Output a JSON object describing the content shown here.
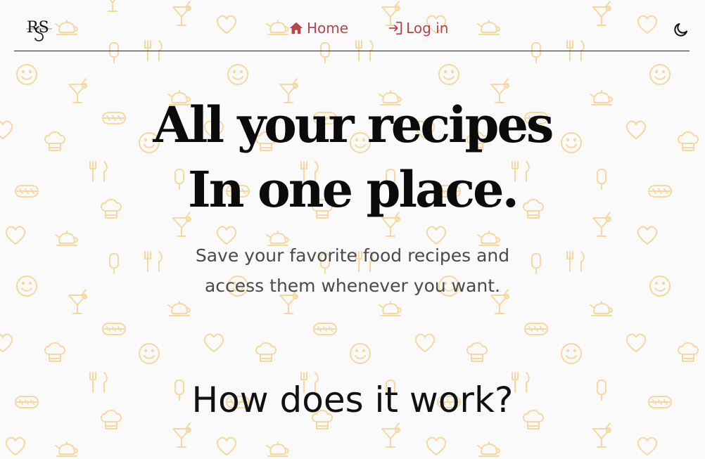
{
  "brand": {
    "logo_text": "RS",
    "logo_icon": "rs-monogram-logo"
  },
  "nav": {
    "items": [
      {
        "label": "Home",
        "icon": "home-icon"
      },
      {
        "label": "Log in",
        "icon": "login-icon"
      }
    ]
  },
  "theme_toggle": {
    "icon": "moon-icon"
  },
  "hero": {
    "title_line1": "All your recipes",
    "title_line2": "In one place.",
    "subtitle_line1": "Save your favorite food recipes and",
    "subtitle_line2": "access them whenever you want."
  },
  "section": {
    "how_title": "How does it work?"
  },
  "colors": {
    "accent": "#b5464a",
    "pattern": "#f5d9a3",
    "background": "#fafafa",
    "text": "#0b0b0b"
  }
}
